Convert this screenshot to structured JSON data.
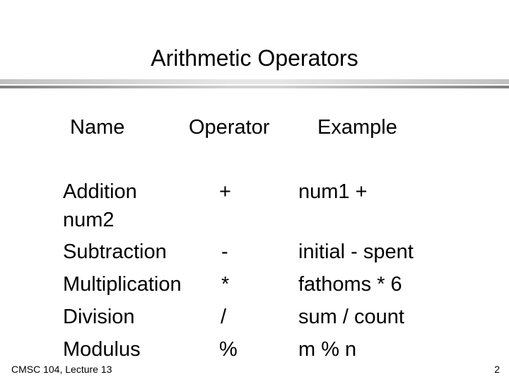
{
  "slide": {
    "title": "Arithmetic Operators",
    "headers": {
      "name": "Name",
      "operator": "Operator",
      "example": "Example"
    },
    "rows": [
      {
        "name": "Addition",
        "operator": "+",
        "example": "num1 +"
      },
      {
        "name": "num2",
        "operator": "",
        "example": ""
      },
      {
        "name": "Subtraction",
        "operator": "-",
        "example": "initial - spent"
      },
      {
        "name": "Multiplication",
        "operator": "*",
        "example": "fathoms * 6"
      },
      {
        "name": "Division",
        "operator": "/",
        "example": "sum / count"
      },
      {
        "name": "Modulus",
        "operator": "%",
        "example": "m % n"
      }
    ],
    "footer": {
      "course": "CMSC 104, Lecture 13",
      "page_number": "2"
    }
  }
}
